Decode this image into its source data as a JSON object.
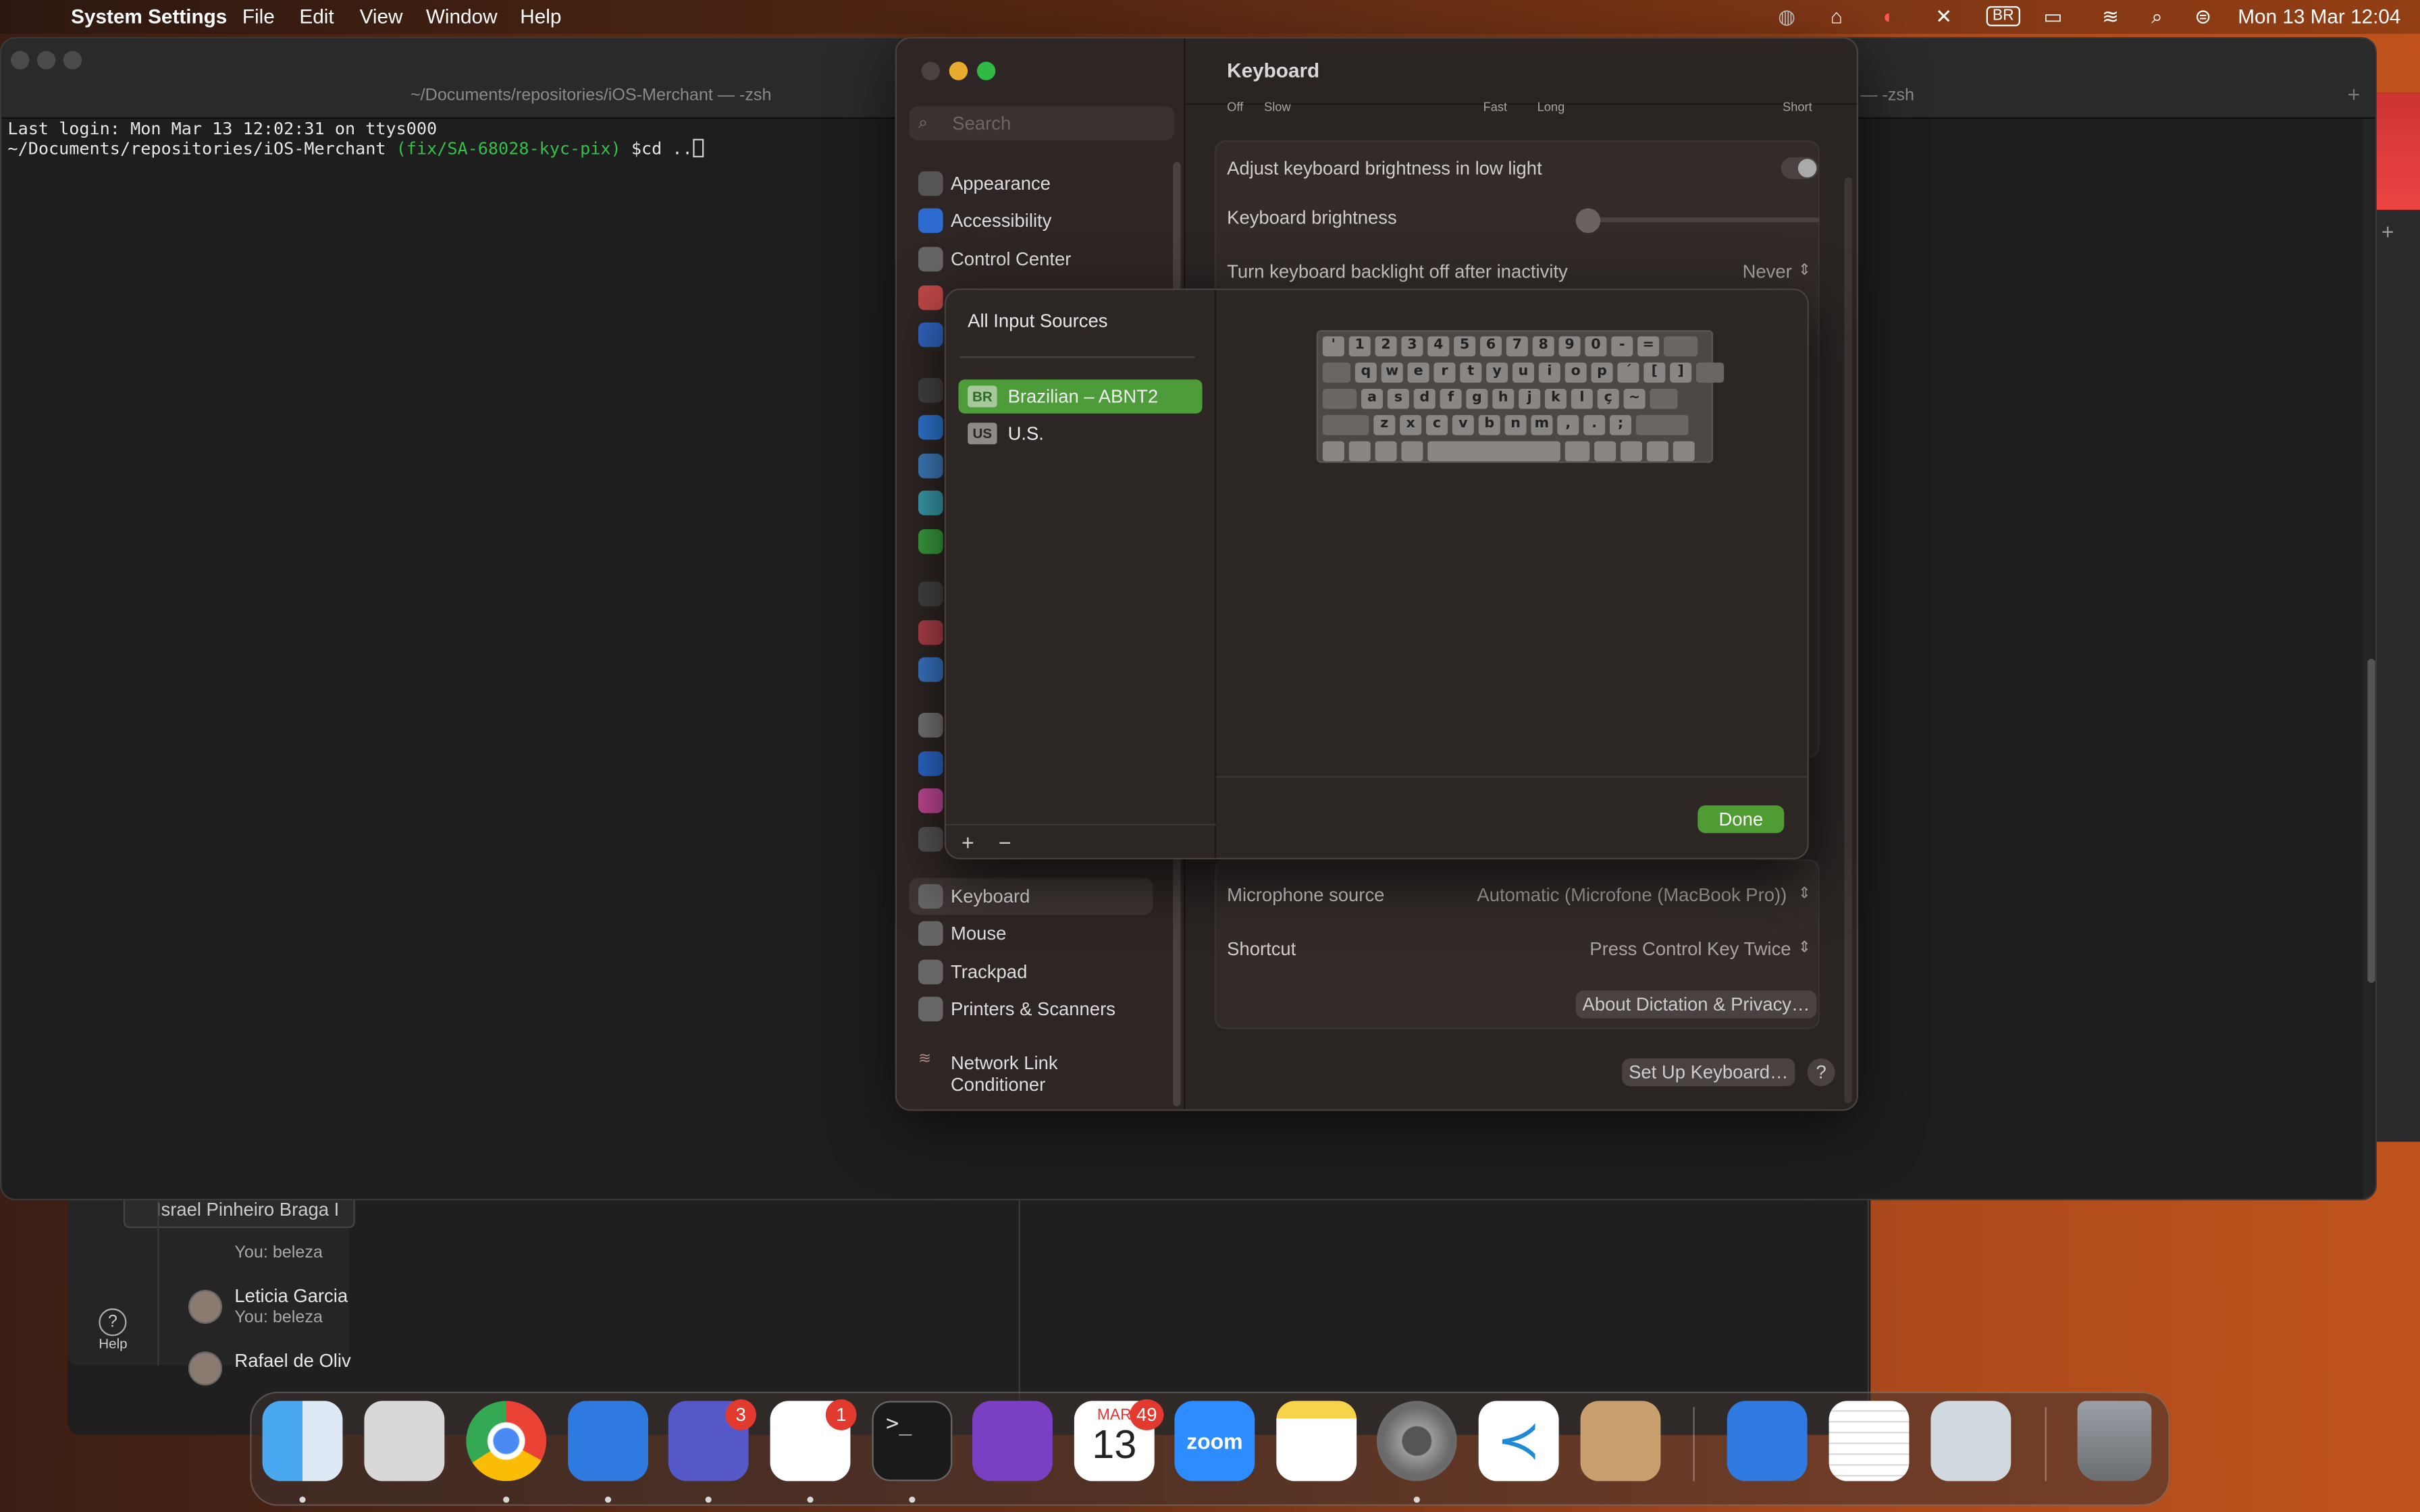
{
  "menubar": {
    "app_name": "System Settings",
    "items": [
      "File",
      "Edit",
      "View",
      "Window",
      "Help"
    ],
    "input_source": "BR",
    "datetime": "Mon 13 Mar  12:04"
  },
  "terminal": {
    "title": "~/Documents/repositories/iOS-Merchant — -zsh",
    "title_tab2": "hant — -zsh",
    "line1": "Last login: Mon Mar 13 12:02:31 on ttys000",
    "prompt_path": "~/Documents/repositories/iOS-Merchant ",
    "branch": "(fix/SA-68028-kyc-pix)",
    "command": " $cd .."
  },
  "settings": {
    "search_placeholder": "Search",
    "sidebar": [
      "Appearance",
      "Accessibility",
      "Control Center",
      "Keyboard",
      "Mouse",
      "Trackpad",
      "Printers & Scanners",
      "Network Link Conditioner"
    ],
    "title": "Keyboard",
    "slider_labels": [
      "Off",
      "Slow",
      "Fast",
      "Long",
      "Short"
    ],
    "rows": {
      "adjust_brightness": "Adjust keyboard brightness in low light",
      "brightness": "Keyboard brightness",
      "backlight_off": "Turn keyboard backlight off after inactivity",
      "backlight_off_value": "Never",
      "mic_source": "Microphone source",
      "mic_source_value": "Automatic (Microfone (MacBook Pro))",
      "shortcut": "Shortcut",
      "shortcut_value": "Press Control Key Twice"
    },
    "about_button": "About Dictation & Privacy…",
    "setup_button": "Set Up Keyboard…",
    "help_button": "?"
  },
  "sheet": {
    "header": "All Input Sources",
    "sources": [
      {
        "badge": "BR",
        "label": "Brazilian – ABNT2",
        "selected": true
      },
      {
        "badge": "US",
        "label": "U.S.",
        "selected": false
      }
    ],
    "add": "+",
    "remove": "−",
    "done": "Done",
    "keyboard_rows": [
      [
        "'",
        "1",
        "2",
        "3",
        "4",
        "5",
        "6",
        "7",
        "8",
        "9",
        "0",
        "-",
        "="
      ],
      [
        "q",
        "w",
        "e",
        "r",
        "t",
        "y",
        "u",
        "i",
        "o",
        "p",
        "´",
        "[",
        "]"
      ],
      [
        "a",
        "s",
        "d",
        "f",
        "g",
        "h",
        "j",
        "k",
        "l",
        "ç",
        "~"
      ],
      [
        "z",
        "x",
        "c",
        "v",
        "b",
        "n",
        "m",
        ",",
        ".",
        ";"
      ]
    ]
  },
  "teams": {
    "tooltip": "Israel Pinheiro Braga I",
    "chat1_sub": "You: beleza",
    "chat2_name": "Leticia Garcia",
    "chat2_sub": "You: beleza",
    "chat3_name": "Rafael de Oliv",
    "help": "Help"
  },
  "dock": {
    "apps": [
      "Finder",
      "Launchpad",
      "Chrome",
      "Xcode",
      "Teams",
      "Slack",
      "Terminal",
      "GitHub Desktop",
      "Calendar",
      "Zoom",
      "Notes",
      "System Settings",
      "VS Code",
      "Archive Utility",
      "App Store",
      "TextEdit",
      "Preview",
      "Trash"
    ],
    "teams_badge": "3",
    "slack_badge": "1",
    "calendar_badge": "49",
    "calendar_month": "MAR",
    "calendar_day": "13",
    "zoom_label": "zoom",
    "terminal_glyph": ">_"
  },
  "colors": {
    "accent_green": "#4f9c32",
    "badge_red": "#e23a2e",
    "branch_green": "#33c14a"
  }
}
